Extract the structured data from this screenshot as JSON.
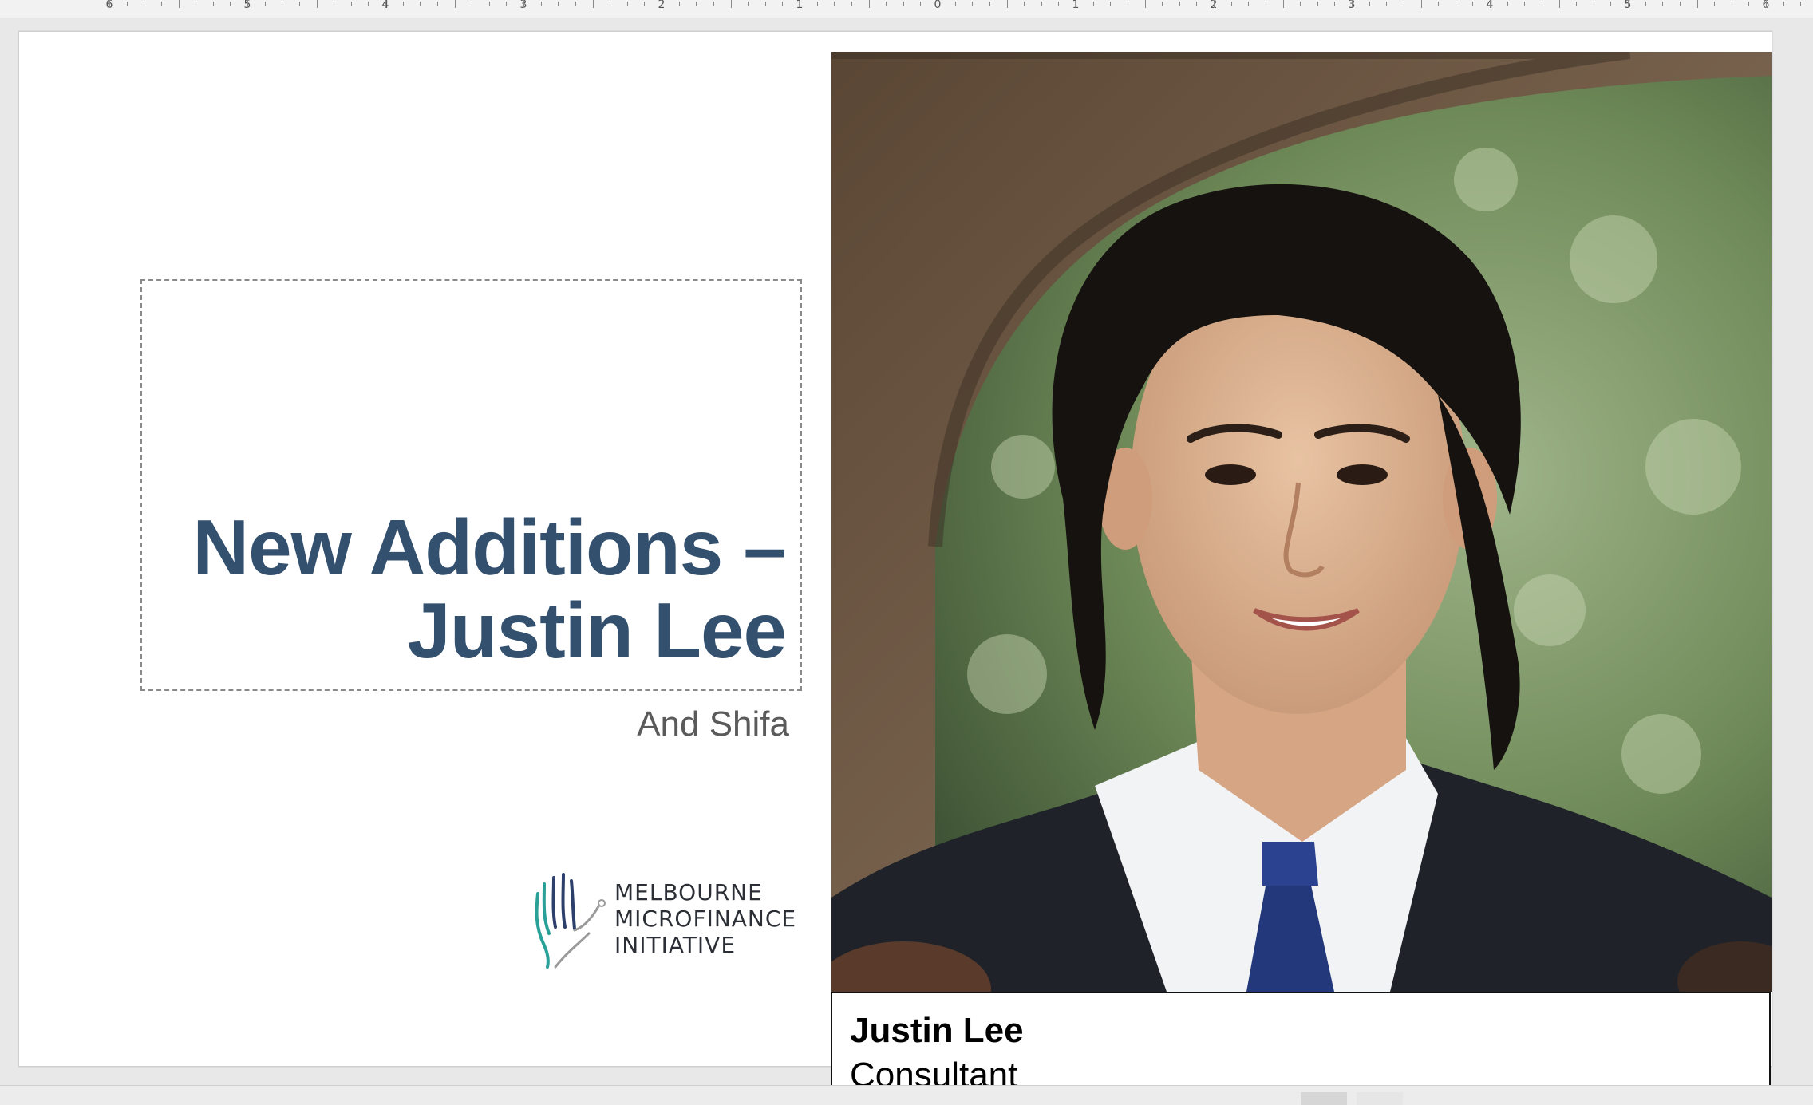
{
  "ruler": {
    "labels": [
      "6",
      "5",
      "4",
      "3",
      "2",
      "1",
      "0",
      "1",
      "2",
      "3",
      "4",
      "5",
      "6"
    ]
  },
  "slide": {
    "title_line1": "New Additions –",
    "title_line2": "Justin Lee",
    "subtitle": "And Shifa",
    "logo": {
      "line1": "MELBOURNE",
      "line2": "MICROFINANCE",
      "line3": "INITIATIVE",
      "icon": "hand-logo-icon"
    },
    "photo": {
      "icon": "portrait-photo"
    },
    "caption": {
      "name": "Justin Lee",
      "role": "Consultant"
    }
  },
  "colors": {
    "title": "#33506e",
    "subtitle": "#5a5a5a",
    "logo_teal": "#2aa198",
    "logo_navy": "#2d3f6b"
  }
}
